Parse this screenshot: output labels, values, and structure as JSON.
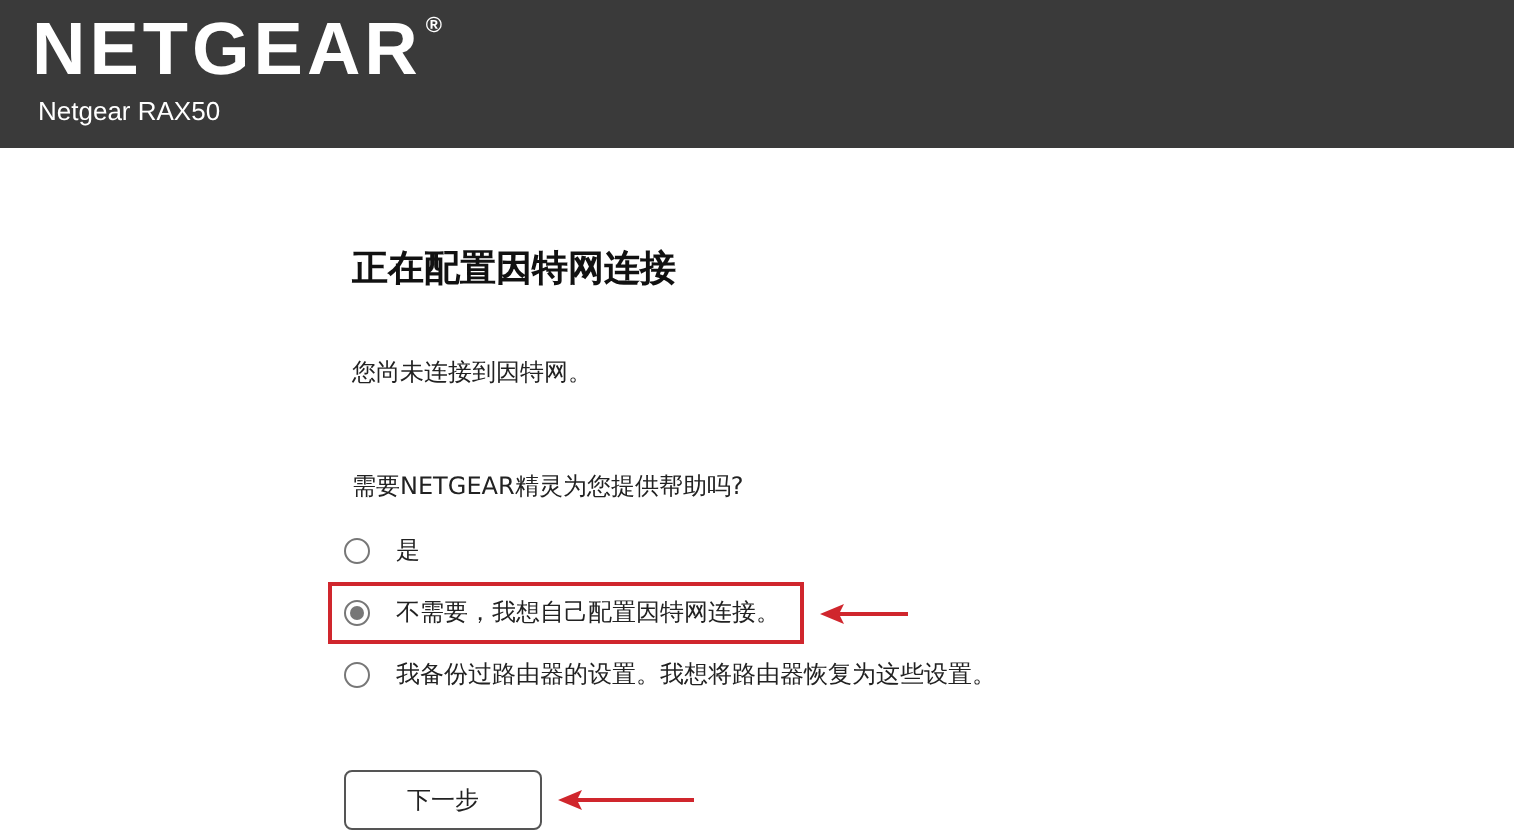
{
  "header": {
    "logo": "NETGEAR",
    "logo_mark": "®",
    "model": "Netgear RAX50"
  },
  "title": "正在配置因特网连接",
  "status": "您尚未连接到因特网。",
  "question": "需要NETGEAR精灵为您提供帮助吗?",
  "options": [
    {
      "label": "是",
      "selected": false,
      "highlight_box": false,
      "arrow": false
    },
    {
      "label": "不需要，我想自己配置因特网连接。",
      "selected": true,
      "highlight_box": true,
      "arrow": true
    },
    {
      "label": "我备份过路由器的设置。我想将路由器恢复为这些设置。",
      "selected": false,
      "highlight_box": false,
      "arrow": false
    }
  ],
  "next_button": {
    "label": "下一步",
    "arrow": true
  }
}
